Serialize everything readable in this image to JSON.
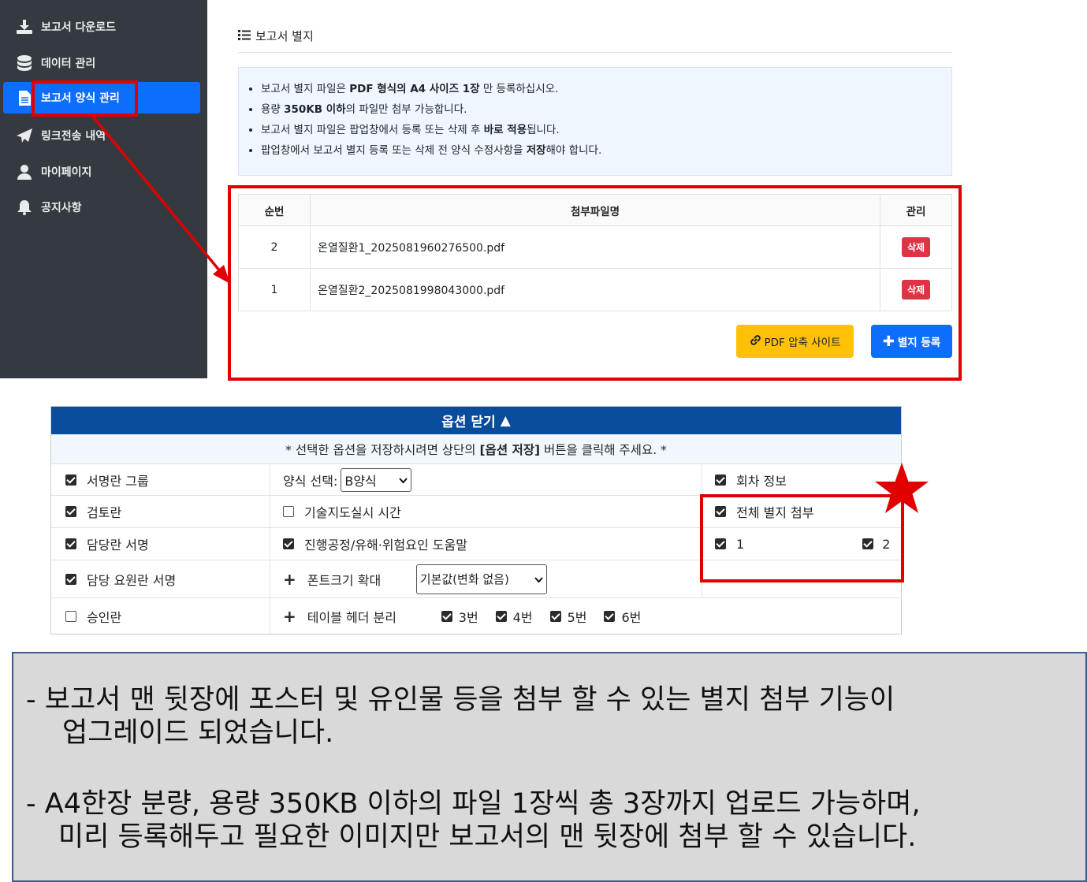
{
  "sidebar": {
    "items": [
      {
        "label": "보고서 다운로드",
        "icon": "download-icon"
      },
      {
        "label": "데이터 관리",
        "icon": "database-icon"
      },
      {
        "label": "보고서 양식 관리",
        "icon": "file-icon",
        "active": true
      },
      {
        "label": "링크전송 내역",
        "icon": "paper-plane-icon"
      },
      {
        "label": "마이페이지",
        "icon": "user-icon"
      },
      {
        "label": "공지사항",
        "icon": "bell-icon"
      }
    ]
  },
  "panel": {
    "title": "보고서 별지",
    "notices": [
      [
        {
          "t": "보고서 별지 파일은 "
        },
        {
          "t": "PDF 형식의 A4 사이즈 1장",
          "b": true
        },
        {
          "t": " 만 등록하십시오."
        }
      ],
      [
        {
          "t": "용량 "
        },
        {
          "t": "350KB 이하",
          "b": true
        },
        {
          "t": "의 파일만 첨부 가능합니다."
        }
      ],
      [
        {
          "t": "보고서 별지 파일은 팝업창에서 등록 또는 삭제 후 "
        },
        {
          "t": "바로 적용",
          "b": true
        },
        {
          "t": "됩니다."
        }
      ],
      [
        {
          "t": "팝업창에서 보고서 별지 등록 또는 삭제 전 양식 수정사항을 "
        },
        {
          "t": "저장",
          "b": true
        },
        {
          "t": "해야 합니다."
        }
      ]
    ],
    "table": {
      "headers": [
        "순번",
        "첨부파일명",
        "관리"
      ],
      "rows": [
        {
          "no": "2",
          "name": "온열질환1_2025081960276500.pdf",
          "action": "삭제"
        },
        {
          "no": "1",
          "name": "온열질환2_2025081998043000.pdf",
          "action": "삭제"
        }
      ]
    },
    "compress_button": "PDF 압축 사이트",
    "register_button": "별지 등록"
  },
  "options": {
    "header": "옵션 닫기",
    "hint_prefix": "* 선택한 옵션을 저장하시려면 상단의 ",
    "hint_bold": "[옵션 저장]",
    "hint_suffix": " 버튼을 클릭해 주세요. *",
    "col1": [
      {
        "label": "서명란 그룹",
        "checked": true
      },
      {
        "label": "검토란",
        "checked": true
      },
      {
        "label": "담당란 서명",
        "checked": true
      },
      {
        "label": "담당 요원란 서명",
        "checked": true
      },
      {
        "label": "승인란",
        "checked": false
      }
    ],
    "form_select_label": "양식 선택:",
    "form_select_value": "B양식",
    "tech_guidance": {
      "label": "기술지도실시 시간",
      "checked": false
    },
    "process_help": {
      "label": "진행공정/유해·위험요인 도움말",
      "checked": true
    },
    "font_enlarge_label": "폰트크기 확대",
    "font_enlarge_value": "기본값(변화 없음)",
    "table_header_label": "테이블 헤더 분리",
    "table_header_options": [
      {
        "label": "3번",
        "checked": true
      },
      {
        "label": "4번",
        "checked": true
      },
      {
        "label": "5번",
        "checked": true
      },
      {
        "label": "6번",
        "checked": true
      }
    ],
    "session_info": {
      "label": "회차 정보",
      "checked": true
    },
    "attach_all": {
      "label": "전체 별지 첨부",
      "checked": true
    },
    "attach_items": [
      {
        "label": "1",
        "checked": true
      },
      {
        "label": "2",
        "checked": true
      }
    ]
  },
  "note": {
    "bullet1_line1": "- 보고서 맨 뒷장에 포스터 및 유인물 등을 첨부 할 수 있는 별지 첨부 기능이",
    "bullet1_line2": "업그레이드 되었습니다.",
    "bullet2_line1": "- A4한장 분량, 용량 350KB 이하의 파일 1장씩 총 3장까지 업로드 가능하며,",
    "bullet2_line2": "미리 등록해두고 필요한 이미지만 보고서의 맨 뒷장에 첨부 할 수 있습니다."
  },
  "colors": {
    "sidebar_bg": "#343a40",
    "primary": "#0d6efd",
    "danger": "#dc3545",
    "warning": "#ffc107",
    "option_header": "#0a4c9c",
    "annotation_red": "#e00000"
  }
}
